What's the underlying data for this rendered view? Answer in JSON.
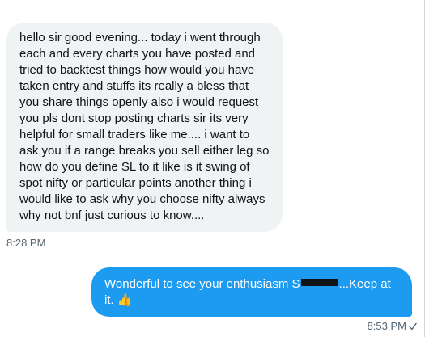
{
  "conversation": {
    "received": {
      "text": "hello sir good evening... today i went through each and every charts you have posted and tried to backtest things how would you have taken entry and stuffs its really a bless that you share things openly also i would request you pls dont stop posting charts sir its very helpful for small traders like me.... i want to ask you if a range breaks you sell either leg so how do you define SL to it like is it swing of spot nifty or particular points another thing i would like to ask why you choose nifty always why not bnf just curious to know....",
      "time": "8:28 PM"
    },
    "sent": {
      "text_before": "Wonderful to see your enthusiasm S",
      "text_after": "...Keep at it.",
      "time": "8:53 PM",
      "status_icon": "check-icon",
      "emoji": "👍"
    }
  },
  "colors": {
    "received_bg": "#eff3f4",
    "sent_bg": "#1d9bf0",
    "meta_text": "#536471"
  }
}
